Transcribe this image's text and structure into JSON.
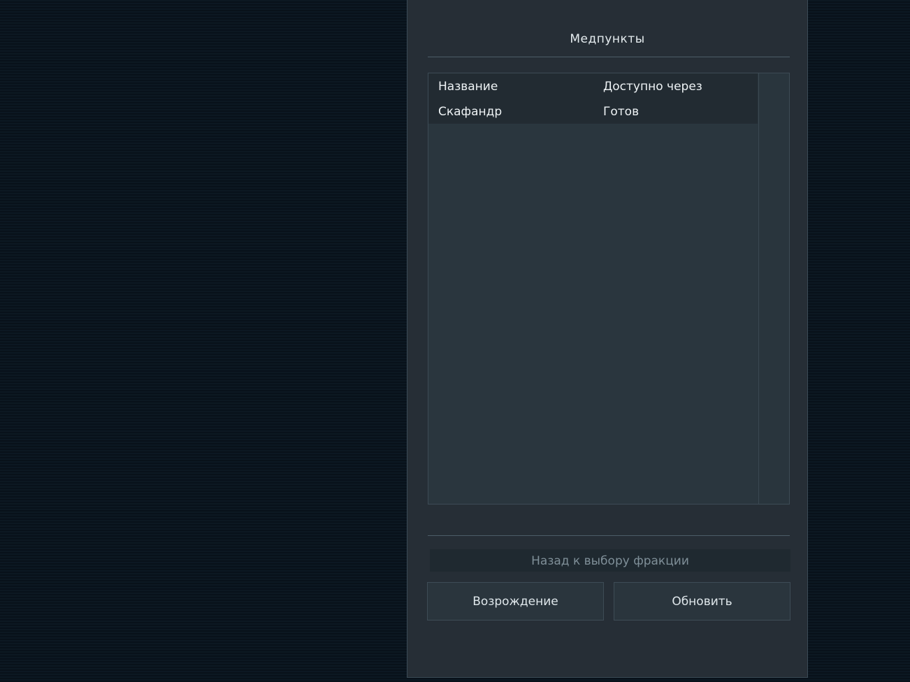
{
  "panel": {
    "title": "Медпункты"
  },
  "list": {
    "rows": [
      {
        "name": "Название",
        "status": "Доступно через"
      },
      {
        "name": "Скафандр",
        "status": "Готов"
      }
    ]
  },
  "buttons": {
    "back_label": "Назад к выбору фракции",
    "respawn_label": "Возрождение",
    "refresh_label": "Обновить"
  }
}
